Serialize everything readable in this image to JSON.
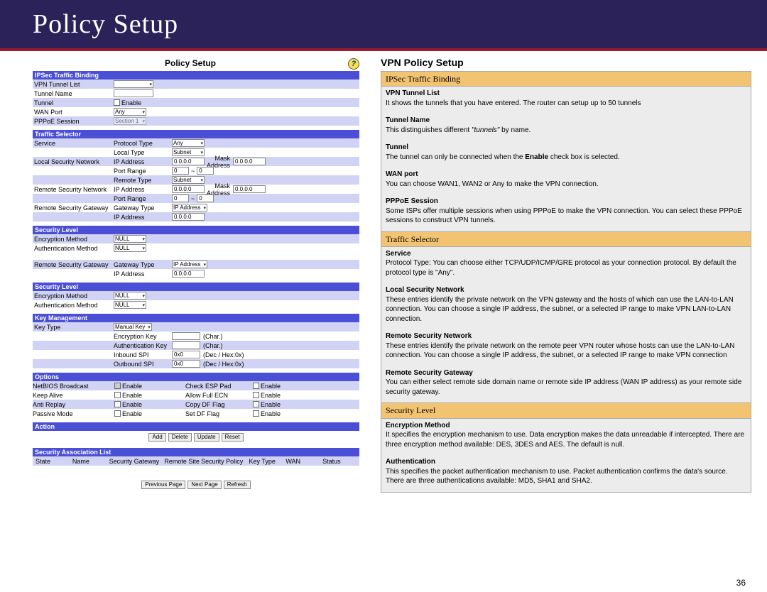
{
  "title_bar": "Policy Setup",
  "page_number": "36",
  "left": {
    "form_title": "Policy Setup",
    "ipsec_hdr": "IPSec Traffic Binding",
    "vpn_tunnel_list": "VPN Tunnel List",
    "tunnel_name": "Tunnel Name",
    "tunnel": "Tunnel",
    "enable": "Enable",
    "wan_port": "WAN Port",
    "wan_val": "Any",
    "pppoe": "PPPoE Session",
    "pppoe_val": "Section 1",
    "traffic_hdr": "Traffic Selector",
    "service": "Service",
    "proto_type": "Protocol Type",
    "proto_val": "Any",
    "local_type": "Local Type",
    "subnet": "Subnet",
    "local_sec": "Local Security Network",
    "ip_addr": "IP Address",
    "ip_zero": "0.0.0.0",
    "mask_addr": "Mask Address",
    "port_range": "Port Range",
    "zero": "0",
    "tilde": "~",
    "remote_type": "Remote Type",
    "remote_sec": "Remote Security Network",
    "remote_gate": "Remote Security Gateway",
    "gateway_type": "Gateway Type",
    "ipaddr_opt": "IP Address",
    "sec_hdr": "Security Level",
    "enc_method": "Encryption Method",
    "auth_method": "Authentication Method",
    "null_v": "NULL",
    "key_hdr": "Key Management",
    "key_type": "Key Type",
    "manual": "Manual Key",
    "enc_key": "Encryption Key",
    "auth_key": "Authentication Key",
    "char": "(Char.)",
    "in_spi": "Inbound SPI",
    "out_spi": "Outbound SPI",
    "hex": "0x0",
    "dechex": "(Dec / Hex:0x)",
    "opt_hdr": "Options",
    "netbios": "NetBIOS Broadcast",
    "check_esp": "Check ESP Pad",
    "keepalive": "Keep Alive",
    "allow_ecn": "Allow Full ECN",
    "antireplay": "Anti Replay",
    "copy_df": "Copy DF Flag",
    "passive": "Passive Mode",
    "set_df": "Set DF Flag",
    "action_hdr": "Action",
    "add": "Add",
    "delete": "Delete",
    "update": "Update",
    "reset": "Reset",
    "sa_hdr": "Security Association List",
    "state": "State",
    "name": "Name",
    "sec_gate_col": "Security Gateway",
    "rem_site": "Remote Site",
    "sec_pol": "Security Policy",
    "key_type_col": "Key Type",
    "wan_col": "WAN",
    "status": "Status",
    "prev": "Previous Page",
    "next": "Next Page",
    "refresh": "Refresh"
  },
  "right": {
    "title": "VPN Policy Setup",
    "s1": "IPSec Traffic Binding",
    "i1t": "VPN Tunnel List",
    "i1d": "It shows the tunnels that you have entered. The router can setup up to 50 tunnels",
    "i2t": "Tunnel Name",
    "i2d": "This distinguishes different \"tunnels\" by name.",
    "i3t": "Tunnel",
    "i3d": "The tunnel can only be connected when the Enable check box is selected.",
    "i4t": "WAN port",
    "i4d": "You can choose WAN1, WAN2 or Any to make the VPN connection.",
    "i5t": "PPPoE Session",
    "i5d": "Some ISPs offer multiple sessions when using PPPoE to make the VPN connection. You can select these PPPoE sessions to construct VPN tunnels.",
    "s2": "Traffic Selector",
    "i6t": "Service",
    "i6d": "Protocol Type: You can choose either TCP/UDP/ICMP/GRE protocol as your connection protocol. By default the protocol type is \"Any\".",
    "i7t": "Local Security Network",
    "i7d": "These entries identify the private network on the VPN gateway and the hosts of which can use the LAN-to-LAN connection. You can choose a single IP address, the subnet, or a selected IP range to make VPN LAN-to-LAN connection.",
    "i8t": "Remote Security Network",
    "i8d": "These entries identify the private network on the remote peer VPN router whose hosts can use the LAN-to-LAN connection. You can choose a single IP address, the subnet, or a selected IP range to make VPN connection",
    "i9t": "Remote Security Gateway",
    "i9d": "You can either select remote side domain name or remote side IP address (WAN IP address) as your remote side security gateway.",
    "s3": "Security Level",
    "i10t": "Encryption Method",
    "i10d": "It specifies the encryption mechanism to use. Data encryption makes the data unreadable if intercepted. There are three encryption method available: DES, 3DES and AES. The default is null.",
    "i11t": "Authentication",
    "i11d": "This specifies the packet authentication mechanism to use. Packet authentication confirms the data's source. There are three authentications available: MD5, SHA1 and SHA2."
  }
}
